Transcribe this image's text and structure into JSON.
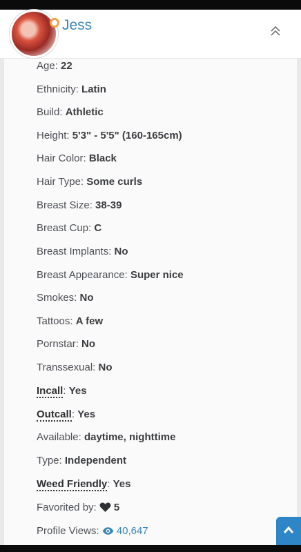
{
  "profile": {
    "name": "Jess",
    "brand_color": "#3a86b8",
    "badge_color": "#f0a24a"
  },
  "details": [
    {
      "label": "Age: ",
      "value": "22"
    },
    {
      "label": "Ethnicity: ",
      "value": "Latin"
    },
    {
      "label": "Build: ",
      "value": "Athletic"
    },
    {
      "label": "Height: ",
      "value": "5'3\" - 5'5\" (160-165cm)"
    },
    {
      "label": "Hair Color: ",
      "value": "Black"
    },
    {
      "label": "Hair Type: ",
      "value": "Some curls"
    },
    {
      "label": "Breast Size: ",
      "value": "38-39"
    },
    {
      "label": "Breast Cup: ",
      "value": "C"
    },
    {
      "label": "Breast Implants: ",
      "value": "No"
    },
    {
      "label": "Breast Appearance: ",
      "value": "Super nice"
    },
    {
      "label": "Smokes: ",
      "value": "No"
    },
    {
      "label": "Tattoos: ",
      "value": "A few"
    },
    {
      "label": "Pornstar: ",
      "value": "No"
    },
    {
      "label": "Transsexual: ",
      "value": "No"
    },
    {
      "label": "Incall",
      "value": "Yes"
    },
    {
      "label": "Outcall",
      "value": "Yes"
    },
    {
      "label": "Available: ",
      "value": "daytime, nighttime"
    },
    {
      "label": "Type: ",
      "value": "Independent"
    },
    {
      "label": "Weed Friendly",
      "value": "Yes"
    },
    {
      "label": "Favorited by: ",
      "value": "5"
    },
    {
      "label": "Profile Views: ",
      "value": "40,647"
    }
  ],
  "icons": {
    "collapse": "chevron-double-up-icon",
    "favorite": "heart-icon",
    "views": "eye-icon",
    "scroll_top": "chevron-up-icon"
  }
}
